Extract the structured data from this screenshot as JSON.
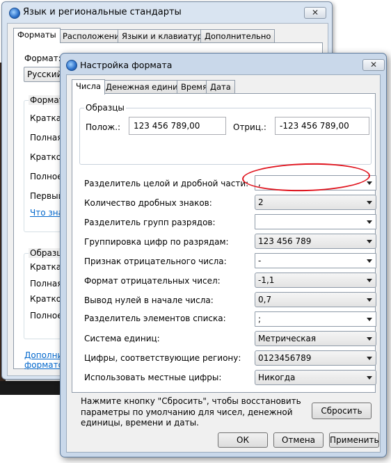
{
  "back_window": {
    "title": "Язык и региональные стандарты",
    "close_label": "✕",
    "tabs": [
      "Форматы",
      "Расположение",
      "Языки и клавиатуры",
      "Дополнительно"
    ],
    "format_label": "Формат:",
    "format_value": "Русский",
    "group1_caption": "Формат",
    "group1_items": [
      "Краткая",
      "Полная",
      "Краткое",
      "Полное",
      "Первый"
    ],
    "link1": "Что знач",
    "group2_caption": "Образц",
    "group2_items": [
      "Краткая",
      "Полная",
      "Краткое",
      "Полное"
    ],
    "bottom_link_line1": "Дополнит",
    "bottom_link_line2": "форматов"
  },
  "dialog": {
    "title": "Настройка формата",
    "close_label": "✕",
    "tabs": [
      "Числа",
      "Денежная единица",
      "Время",
      "Дата"
    ],
    "samples": {
      "caption": "Образцы",
      "positive_label": "Полож.:",
      "positive_value": "123 456 789,00",
      "negative_label": "Отриц.:",
      "negative_value": "-123 456 789,00"
    },
    "rows": [
      {
        "label": "Разделитель целой и дробной части:",
        "value": ","
      },
      {
        "label": "Количество дробных знаков:",
        "value": "2"
      },
      {
        "label": "Разделитель групп разрядов:",
        "value": ""
      },
      {
        "label": "Группировка цифр по разрядам:",
        "value": "123 456 789"
      },
      {
        "label": "Признак отрицательного числа:",
        "value": "-"
      },
      {
        "label": "Формат отрицательных чисел:",
        "value": "-1,1"
      },
      {
        "label": "Вывод нулей в начале числа:",
        "value": "0,7"
      },
      {
        "label": "Разделитель элементов списка:",
        "value": ";"
      },
      {
        "label": "Система единиц:",
        "value": "Метрическая"
      },
      {
        "label": "Цифры, соответствующие региону:",
        "value": "0123456789"
      },
      {
        "label": "Использовать местные цифры:",
        "value": "Никогда"
      }
    ],
    "reset_note": "Нажмите кнопку \"Сбросить\", чтобы восстановить параметры по умолчанию для чисел, денежной единицы, времени и даты.",
    "reset_button": "Сбросить",
    "ok_button": "ОК",
    "cancel_button": "Отмена",
    "apply_button": "Применить",
    "highlight_color": "#e0141e"
  }
}
